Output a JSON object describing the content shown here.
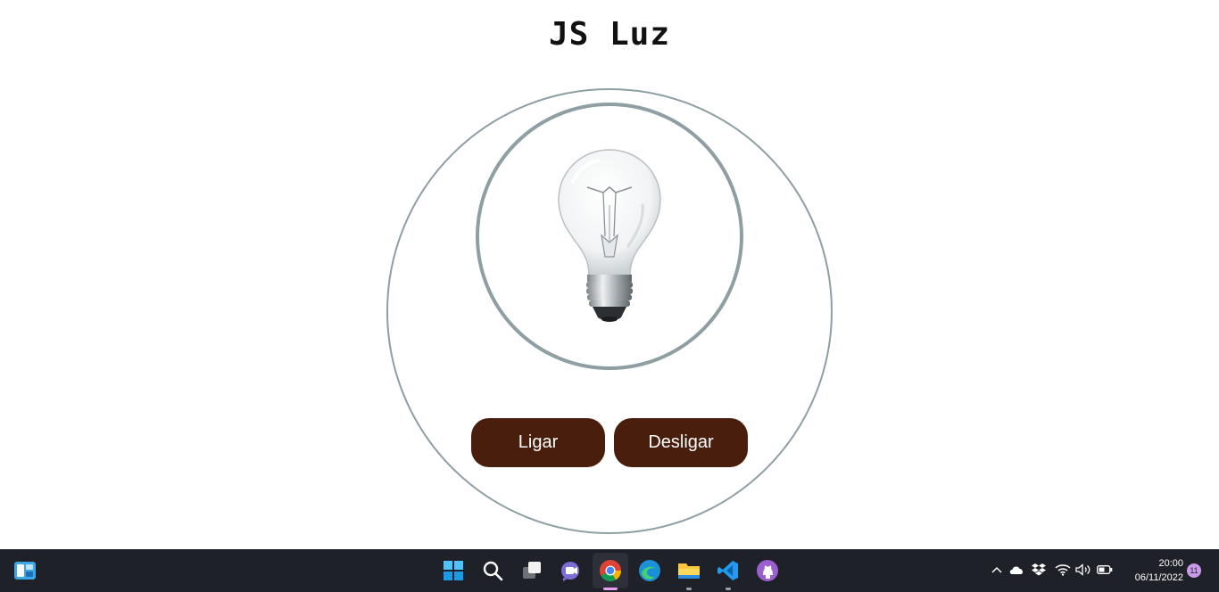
{
  "page": {
    "title": "JS Luz"
  },
  "controls": {
    "on_label": "Ligar",
    "off_label": "Desligar"
  },
  "bulb": {
    "state": "off",
    "icon": "light-bulb-icon"
  },
  "colors": {
    "button_bg": "#4a1e0d",
    "button_text": "#ffffff",
    "circle_border": "#8e9ea3",
    "taskbar_bg": "#1f2128"
  },
  "taskbar": {
    "apps": [
      "widgets",
      "start",
      "search",
      "task-view",
      "teams-chat",
      "chrome",
      "edge",
      "file-explorer",
      "vscode",
      "github-desktop"
    ],
    "active_app": "chrome",
    "tray": [
      "chevron-up",
      "onedrive",
      "dropbox",
      "wifi",
      "volume",
      "battery"
    ],
    "time": "20:00",
    "date": "06/11/2022",
    "notification_count": "11"
  }
}
